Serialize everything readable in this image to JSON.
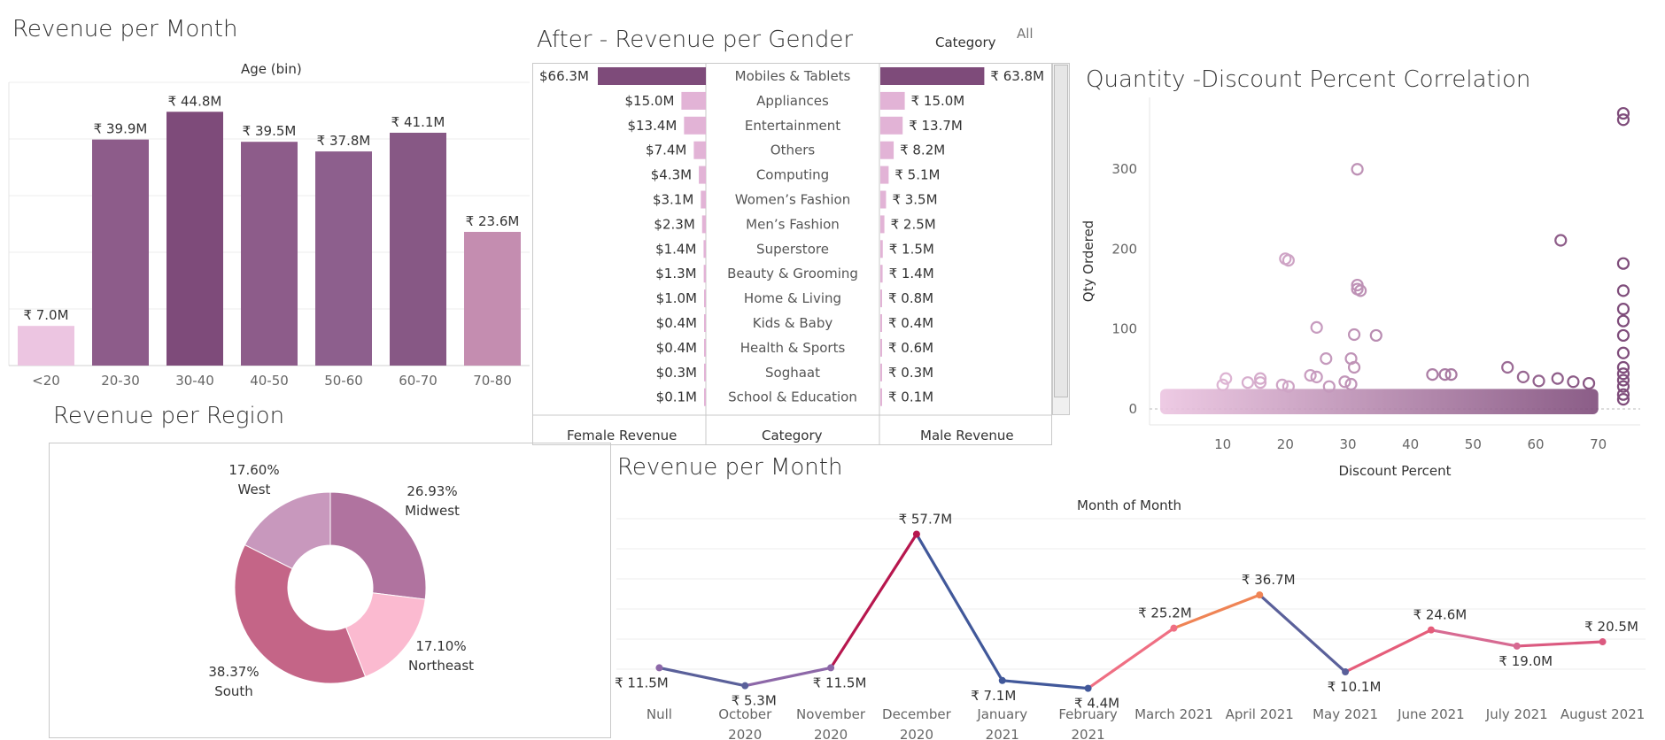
{
  "age_chart": {
    "title": "Revenue per Month",
    "header": "Age (bin)",
    "chart_data": {
      "type": "bar",
      "categories": [
        "<20",
        "20-30",
        "30-40",
        "40-50",
        "50-60",
        "60-70",
        "70-80"
      ],
      "values": [
        7.0,
        39.9,
        44.8,
        39.5,
        37.8,
        41.1,
        23.6
      ],
      "labels": [
        "₹ 7.0M",
        "₹ 39.9M",
        "₹ 44.8M",
        "₹ 39.5M",
        "₹ 37.8M",
        "₹ 41.1M",
        "₹ 23.6M"
      ],
      "colors": [
        "#ecc5e1",
        "#8d5c8a",
        "#7e4b7a",
        "#8d5c8a",
        "#8d5f8d",
        "#875885",
        "#c48db0"
      ],
      "ylim": [
        0,
        50
      ]
    }
  },
  "gender_chart": {
    "title": "After - Revenue per Gender",
    "filter_label": "Category",
    "filter_value": "All",
    "footer_female": "Female Revenue",
    "footer_category": "Category",
    "footer_male": "Male Revenue",
    "chart_data": {
      "type": "bar",
      "categories": [
        "Mobiles & Tablets",
        "Appliances",
        "Entertainment",
        "Others",
        "Computing",
        "Women’s Fashion",
        "Men’s Fashion",
        "Superstore",
        "Beauty & Grooming",
        "Home & Living",
        "Kids & Baby",
        "Health & Sports",
        "Soghaat",
        "School & Education"
      ],
      "series": [
        {
          "name": "Female Revenue",
          "values": [
            66.3,
            15.0,
            13.4,
            7.4,
            4.3,
            3.1,
            2.3,
            1.4,
            1.3,
            1.0,
            0.4,
            0.4,
            0.3,
            0.1
          ],
          "labels": [
            "$66.3M",
            "$15.0M",
            "$13.4M",
            "$7.4M",
            "$4.3M",
            "$3.1M",
            "$2.3M",
            "$1.4M",
            "$1.3M",
            "$1.0M",
            "$0.4M",
            "$0.4M",
            "$0.3M",
            "$0.1M"
          ]
        },
        {
          "name": "Male Revenue",
          "values": [
            63.8,
            15.0,
            13.7,
            8.2,
            5.1,
            3.5,
            2.5,
            1.5,
            1.4,
            0.8,
            0.4,
            0.6,
            0.3,
            0.1
          ],
          "labels": [
            "₹ 63.8M",
            "₹ 15.0M",
            "₹ 13.7M",
            "₹ 8.2M",
            "₹ 5.1M",
            "₹ 3.5M",
            "₹ 2.5M",
            "₹ 1.5M",
            "₹ 1.4M",
            "₹ 0.8M",
            "₹ 0.4M",
            "₹ 0.6M",
            "₹ 0.3M",
            "₹ 0.1M"
          ]
        }
      ],
      "colors": {
        "top": "#7e4b7a",
        "rest": "#e2b3d6"
      }
    }
  },
  "scatter_chart": {
    "title": "Quantity -Discount Percent Correlation",
    "chart_data": {
      "type": "scatter",
      "xlabel": "Discount Percent",
      "ylabel": "Qty Ordered",
      "xticks": [
        10,
        20,
        30,
        40,
        50,
        60,
        70
      ],
      "yticks": [
        0,
        100,
        200,
        300
      ],
      "xlim": [
        0,
        75
      ],
      "ylim": [
        -20,
        390
      ],
      "points": [
        [
          20,
          188
        ],
        [
          20.5,
          186
        ],
        [
          31.5,
          300
        ],
        [
          31.5,
          155
        ],
        [
          31.5,
          150
        ],
        [
          32,
          148
        ],
        [
          25,
          102
        ],
        [
          31,
          93
        ],
        [
          34.5,
          92
        ],
        [
          30.5,
          63
        ],
        [
          26.5,
          63
        ],
        [
          24,
          42
        ],
        [
          25,
          40
        ],
        [
          31,
          52
        ],
        [
          16,
          38
        ],
        [
          16,
          33
        ],
        [
          14,
          33
        ],
        [
          10.5,
          38
        ],
        [
          10,
          30
        ],
        [
          19.5,
          30
        ],
        [
          20.5,
          28
        ],
        [
          27,
          28
        ],
        [
          29.5,
          34
        ],
        [
          30.5,
          31
        ],
        [
          43.5,
          43
        ],
        [
          45.5,
          43
        ],
        [
          46.5,
          43
        ],
        [
          55.5,
          52
        ],
        [
          58,
          40
        ],
        [
          60.5,
          35
        ],
        [
          64,
          211
        ],
        [
          63.5,
          38
        ],
        [
          66,
          34
        ],
        [
          68.5,
          32
        ],
        [
          74,
          370
        ],
        [
          74,
          362
        ],
        [
          74,
          182
        ],
        [
          74,
          148
        ],
        [
          74,
          125
        ],
        [
          74,
          110
        ],
        [
          74,
          92
        ],
        [
          74,
          70
        ],
        [
          74,
          52
        ],
        [
          74,
          44
        ],
        [
          74,
          36
        ],
        [
          74,
          28
        ],
        [
          74,
          18
        ],
        [
          74,
          12
        ]
      ],
      "dense_band": {
        "x": [
          0,
          70
        ],
        "y": [
          0,
          25
        ]
      },
      "colors": {
        "low": "#ecc5e1",
        "high": "#7e4b7a"
      }
    }
  },
  "region_chart": {
    "title": "Revenue per Region",
    "chart_data": {
      "type": "pie",
      "donut": true,
      "slices": [
        {
          "name": "Midwest",
          "value": 26.93,
          "label": "26.93%",
          "color": "#b0739f"
        },
        {
          "name": "Northeast",
          "value": 17.1,
          "label": "17.10%",
          "color": "#fbbad0"
        },
        {
          "name": "South",
          "value": 38.37,
          "label": "38.37%",
          "color": "#c46587"
        },
        {
          "name": "West",
          "value": 17.6,
          "label": "17.60%",
          "color": "#c898bd"
        }
      ]
    }
  },
  "month_chart": {
    "title": "Revenue per Month",
    "header": "Month of Month",
    "chart_data": {
      "type": "line",
      "categories": [
        [
          "Null"
        ],
        [
          "October",
          "2020"
        ],
        [
          "November",
          "2020"
        ],
        [
          "December",
          "2020"
        ],
        [
          "January",
          "2021"
        ],
        [
          "February",
          "2021"
        ],
        [
          "March 2021"
        ],
        [
          "April 2021"
        ],
        [
          "May 2021"
        ],
        [
          "June 2021"
        ],
        [
          "July 2021"
        ],
        [
          "August 2021"
        ]
      ],
      "values": [
        11.5,
        5.3,
        11.5,
        57.7,
        7.1,
        4.4,
        25.2,
        36.7,
        10.1,
        24.6,
        19.0,
        20.5
      ],
      "labels": [
        "₹ 11.5M",
        "₹ 5.3M",
        "₹ 11.5M",
        "₹ 57.7M",
        "₹ 7.1M",
        "₹ 4.4M",
        "₹ 25.2M",
        "₹ 36.7M",
        "₹ 10.1M",
        "₹ 24.6M",
        "₹ 19.0M",
        "₹ 20.5M"
      ],
      "colors": [
        "#8d68a8",
        "#5a609a",
        "#8d68a8",
        "#b7174e",
        "#41589a",
        "#41589a",
        "#ef6f83",
        "#ef8455",
        "#5a609a",
        "#e55d7a",
        "#d76a92",
        "#db5a80"
      ],
      "ylim": [
        0,
        60
      ]
    }
  }
}
